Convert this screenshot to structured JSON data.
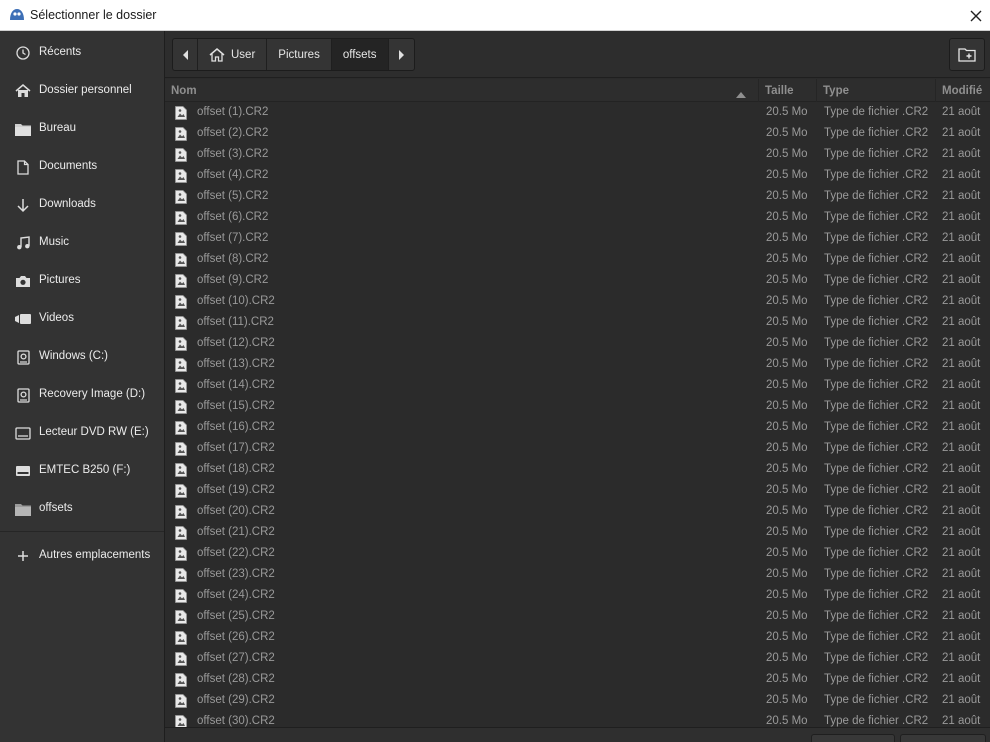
{
  "window": {
    "title": "Sélectionner le dossier"
  },
  "sidebar": {
    "items": [
      {
        "label": "Récents",
        "icon": "clock-icon"
      },
      {
        "label": "Dossier personnel",
        "icon": "home-icon"
      },
      {
        "label": "Bureau",
        "icon": "folder-icon"
      },
      {
        "label": "Documents",
        "icon": "document-icon"
      },
      {
        "label": "Downloads",
        "icon": "download-icon"
      },
      {
        "label": "Music",
        "icon": "music-icon"
      },
      {
        "label": "Pictures",
        "icon": "camera-icon"
      },
      {
        "label": "Videos",
        "icon": "video-icon"
      },
      {
        "label": "Windows (C:)",
        "icon": "drive-icon"
      },
      {
        "label": "Recovery Image (D:)",
        "icon": "drive-icon"
      },
      {
        "label": "Lecteur DVD RW (E:)",
        "icon": "optical-drive-icon"
      },
      {
        "label": "EMTEC B250 (F:)",
        "icon": "usb-drive-icon"
      },
      {
        "label": "offsets",
        "icon": "folder-icon"
      }
    ],
    "other": {
      "label": "Autres emplacements",
      "icon": "plus-icon"
    }
  },
  "pathbar": {
    "segments": [
      {
        "label": "User",
        "icon": "home-icon"
      },
      {
        "label": "Pictures"
      },
      {
        "label": "offsets",
        "active": true
      }
    ]
  },
  "columns": {
    "name": "Nom",
    "size": "Taille",
    "type": "Type",
    "modified": "Modifié"
  },
  "files": [
    {
      "name": "offset (1).CR2",
      "size": "20.5 Mo",
      "type": "Type de fichier .CR2",
      "modified": "21 août"
    },
    {
      "name": "offset (2).CR2",
      "size": "20.5 Mo",
      "type": "Type de fichier .CR2",
      "modified": "21 août"
    },
    {
      "name": "offset (3).CR2",
      "size": "20.5 Mo",
      "type": "Type de fichier .CR2",
      "modified": "21 août"
    },
    {
      "name": "offset (4).CR2",
      "size": "20.5 Mo",
      "type": "Type de fichier .CR2",
      "modified": "21 août"
    },
    {
      "name": "offset (5).CR2",
      "size": "20.5 Mo",
      "type": "Type de fichier .CR2",
      "modified": "21 août"
    },
    {
      "name": "offset (6).CR2",
      "size": "20.5 Mo",
      "type": "Type de fichier .CR2",
      "modified": "21 août"
    },
    {
      "name": "offset (7).CR2",
      "size": "20.5 Mo",
      "type": "Type de fichier .CR2",
      "modified": "21 août"
    },
    {
      "name": "offset (8).CR2",
      "size": "20.5 Mo",
      "type": "Type de fichier .CR2",
      "modified": "21 août"
    },
    {
      "name": "offset (9).CR2",
      "size": "20.5 Mo",
      "type": "Type de fichier .CR2",
      "modified": "21 août"
    },
    {
      "name": "offset (10).CR2",
      "size": "20.5 Mo",
      "type": "Type de fichier .CR2",
      "modified": "21 août"
    },
    {
      "name": "offset (11).CR2",
      "size": "20.5 Mo",
      "type": "Type de fichier .CR2",
      "modified": "21 août"
    },
    {
      "name": "offset (12).CR2",
      "size": "20.5 Mo",
      "type": "Type de fichier .CR2",
      "modified": "21 août"
    },
    {
      "name": "offset (13).CR2",
      "size": "20.5 Mo",
      "type": "Type de fichier .CR2",
      "modified": "21 août"
    },
    {
      "name": "offset (14).CR2",
      "size": "20.5 Mo",
      "type": "Type de fichier .CR2",
      "modified": "21 août"
    },
    {
      "name": "offset (15).CR2",
      "size": "20.5 Mo",
      "type": "Type de fichier .CR2",
      "modified": "21 août"
    },
    {
      "name": "offset (16).CR2",
      "size": "20.5 Mo",
      "type": "Type de fichier .CR2",
      "modified": "21 août"
    },
    {
      "name": "offset (17).CR2",
      "size": "20.5 Mo",
      "type": "Type de fichier .CR2",
      "modified": "21 août"
    },
    {
      "name": "offset (18).CR2",
      "size": "20.5 Mo",
      "type": "Type de fichier .CR2",
      "modified": "21 août"
    },
    {
      "name": "offset (19).CR2",
      "size": "20.5 Mo",
      "type": "Type de fichier .CR2",
      "modified": "21 août"
    },
    {
      "name": "offset (20).CR2",
      "size": "20.5 Mo",
      "type": "Type de fichier .CR2",
      "modified": "21 août"
    },
    {
      "name": "offset (21).CR2",
      "size": "20.5 Mo",
      "type": "Type de fichier .CR2",
      "modified": "21 août"
    },
    {
      "name": "offset (22).CR2",
      "size": "20.5 Mo",
      "type": "Type de fichier .CR2",
      "modified": "21 août"
    },
    {
      "name": "offset (23).CR2",
      "size": "20.5 Mo",
      "type": "Type de fichier .CR2",
      "modified": "21 août"
    },
    {
      "name": "offset (24).CR2",
      "size": "20.5 Mo",
      "type": "Type de fichier .CR2",
      "modified": "21 août"
    },
    {
      "name": "offset (25).CR2",
      "size": "20.5 Mo",
      "type": "Type de fichier .CR2",
      "modified": "21 août"
    },
    {
      "name": "offset (26).CR2",
      "size": "20.5 Mo",
      "type": "Type de fichier .CR2",
      "modified": "21 août"
    },
    {
      "name": "offset (27).CR2",
      "size": "20.5 Mo",
      "type": "Type de fichier .CR2",
      "modified": "21 août"
    },
    {
      "name": "offset (28).CR2",
      "size": "20.5 Mo",
      "type": "Type de fichier .CR2",
      "modified": "21 août"
    },
    {
      "name": "offset (29).CR2",
      "size": "20.5 Mo",
      "type": "Type de fichier .CR2",
      "modified": "21 août"
    },
    {
      "name": "offset (30).CR2",
      "size": "20.5 Mo",
      "type": "Type de fichier .CR2",
      "modified": "21 août"
    }
  ],
  "colors": {
    "background": "#2b2b2b",
    "sidebar": "#333333",
    "text": "#e8e8e8",
    "dim_text": "#9a9a9a",
    "titlebar": "#ffffff"
  }
}
